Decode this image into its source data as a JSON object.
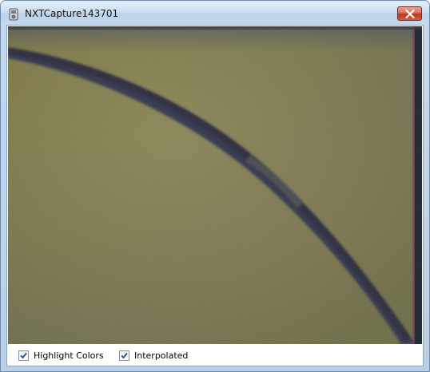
{
  "window": {
    "title": "NXTCapture143701",
    "icon": "app-camera-icon"
  },
  "titlebar": {
    "close_icon": "close-icon",
    "close_color": "#c8412a"
  },
  "camera": {
    "description_icon": "captured-camera-image"
  },
  "controls": {
    "highlight_colors": {
      "label": "Highlight Colors",
      "checked": true
    },
    "interpolated": {
      "label": "Interpolated",
      "checked": true
    }
  }
}
